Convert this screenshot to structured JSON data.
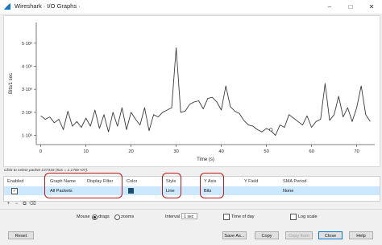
{
  "window": {
    "title": "Wireshark · I/O Graphs ·",
    "controls": [
      "–",
      "□",
      "✕"
    ]
  },
  "chart_data": {
    "type": "line",
    "ylabel": "Bits/1 sec",
    "xlabel": "Time (s)",
    "x_ticks": [
      "0",
      "10",
      "20",
      "30",
      "40",
      "50",
      "60",
      "70"
    ],
    "y_ticks": [
      "1·10⁶",
      "2·10⁶",
      "3·10⁶",
      "4·10⁶",
      "5·10⁶"
    ],
    "xlim": [
      -1,
      74
    ],
    "ylim": [
      600000,
      5900000
    ],
    "grid": false,
    "series": [
      {
        "values": [
          [
            0,
            1850000
          ],
          [
            1,
            1700000
          ],
          [
            2,
            1800000
          ],
          [
            3,
            1550000
          ],
          [
            4,
            1700000
          ],
          [
            5,
            1250000
          ],
          [
            6,
            2050000
          ],
          [
            7,
            1400000
          ],
          [
            8,
            1600000
          ],
          [
            9,
            1350000
          ],
          [
            10,
            1750000
          ],
          [
            11,
            1400000
          ],
          [
            12,
            2100000
          ],
          [
            13,
            1300000
          ],
          [
            14,
            1900000
          ],
          [
            15,
            1150000
          ],
          [
            16,
            2000000
          ],
          [
            17,
            1400000
          ],
          [
            18,
            2200000
          ],
          [
            19,
            1250000
          ],
          [
            20,
            2000000
          ],
          [
            21,
            1700000
          ],
          [
            22,
            1450000
          ],
          [
            23,
            2200000
          ],
          [
            24,
            1200000
          ],
          [
            25,
            1900000
          ],
          [
            26,
            1800000
          ],
          [
            27,
            2000000
          ],
          [
            28,
            2100000
          ],
          [
            29,
            2200000
          ],
          [
            30,
            4800000
          ],
          [
            31,
            2000000
          ],
          [
            32,
            2050000
          ],
          [
            33,
            2350000
          ],
          [
            34,
            2450000
          ],
          [
            35,
            2500000
          ],
          [
            36,
            2150000
          ],
          [
            37,
            2600000
          ],
          [
            38,
            2650000
          ],
          [
            39,
            2450000
          ],
          [
            40,
            2100000
          ],
          [
            41,
            3150000
          ],
          [
            42,
            2250000
          ],
          [
            43,
            2050000
          ],
          [
            44,
            1950000
          ],
          [
            45,
            1650000
          ],
          [
            46,
            1450000
          ],
          [
            47,
            1400000
          ],
          [
            48,
            1250000
          ],
          [
            49,
            1150000
          ],
          [
            50,
            1300000
          ],
          [
            51,
            1200000
          ],
          [
            52,
            1000000
          ],
          [
            53,
            1450000
          ],
          [
            54,
            1350000
          ],
          [
            55,
            1900000
          ],
          [
            56,
            1750000
          ],
          [
            57,
            1600000
          ],
          [
            58,
            1450000
          ],
          [
            59,
            1850000
          ],
          [
            60,
            1350000
          ],
          [
            61,
            1600000
          ],
          [
            62,
            1700000
          ],
          [
            63,
            3250000
          ],
          [
            64,
            1650000
          ],
          [
            65,
            1900000
          ],
          [
            66,
            2700000
          ],
          [
            67,
            1800000
          ],
          [
            68,
            2200000
          ],
          [
            69,
            1600000
          ],
          [
            70,
            2200000
          ],
          [
            71,
            3150000
          ],
          [
            72,
            1900000
          ],
          [
            73,
            1600000
          ]
        ]
      }
    ],
    "marker_point": [
      51,
      1250000
    ],
    "line_color": "#3a3a3a"
  },
  "status_hint": "Click to select packet 137318 (51s = 1.176e+07).",
  "table": {
    "headers": [
      "Enabled",
      "Graph Name",
      "Display Filter",
      "Color",
      "Style",
      "Y Axis",
      "Y Field",
      "SMA Period"
    ],
    "row": {
      "enabled": true,
      "graph_name": "All Packets",
      "display_filter": "",
      "color": "#1a4d72",
      "style": "Line",
      "y_axis": "Bits",
      "y_field": "",
      "sma_period": "None"
    },
    "highlight_color": "#c01818"
  },
  "toolbar": {
    "buttons": [
      "+",
      "−",
      "⧉",
      "⌫"
    ]
  },
  "options": {
    "mouse_label": "Mouse",
    "mouse_modes": [
      {
        "label": "drags",
        "selected": true
      },
      {
        "label": "zooms",
        "selected": false
      }
    ],
    "interval_label": "Interval",
    "interval_value": "1 sec",
    "time_of_day_label": "Time of day",
    "log_scale_label": "Log scale"
  },
  "buttons": {
    "reset": "Reset",
    "save_as": "Save As...",
    "copy": "Copy",
    "copy_from": "Copy from",
    "close": "Close",
    "help": "Help"
  }
}
